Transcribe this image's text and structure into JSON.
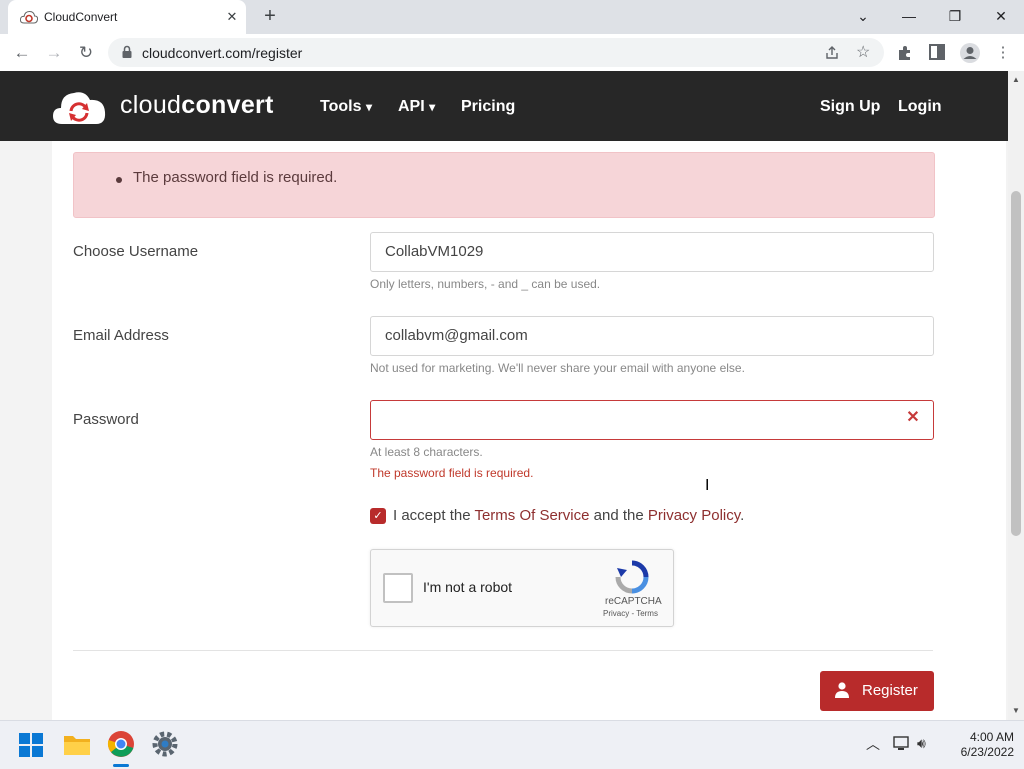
{
  "browser": {
    "tab_title": "CloudConvert",
    "tab_close": "✕",
    "new_tab": "+",
    "url": "cloudconvert.com/register",
    "window_buttons": {
      "dropdown": "⌄",
      "minimize": "—",
      "restore": "❐",
      "close": "✕"
    }
  },
  "site": {
    "logo_light": "cloud",
    "logo_bold": "convert",
    "nav": {
      "tools": "Tools",
      "api": "API",
      "pricing": "Pricing",
      "signup": "Sign Up",
      "login": "Login"
    },
    "chevron": "⌄"
  },
  "form": {
    "alert": "The password field is required.",
    "username": {
      "label": "Choose Username",
      "value": "CollabVM1029",
      "help": "Only letters, numbers, - and _ can be used."
    },
    "email": {
      "label": "Email Address",
      "value": "collabvm@gmail.com",
      "help": "Not used for marketing. We'll never share your email with anyone else."
    },
    "password": {
      "label": "Password",
      "value": "",
      "help": "At least 8 characters.",
      "error": "The password field is required.",
      "clear": "✕"
    },
    "tos": {
      "prefix": "I accept the ",
      "terms_link": "Terms Of Service",
      "middle": " and the ",
      "privacy_link": "Privacy Policy",
      "suffix": ".",
      "checked": true,
      "check_glyph": "✓"
    },
    "captcha": {
      "label": "I'm not a robot",
      "brand": "reCAPTCHA",
      "links": "Privacy - Terms"
    },
    "submit": "Register"
  },
  "taskbar": {
    "time": "4:00 AM",
    "date": "6/23/2022",
    "tray_up": "︿"
  },
  "colors": {
    "accent": "#b82b2b",
    "header_bg": "#272727",
    "alert_bg": "#f6d5d8"
  }
}
